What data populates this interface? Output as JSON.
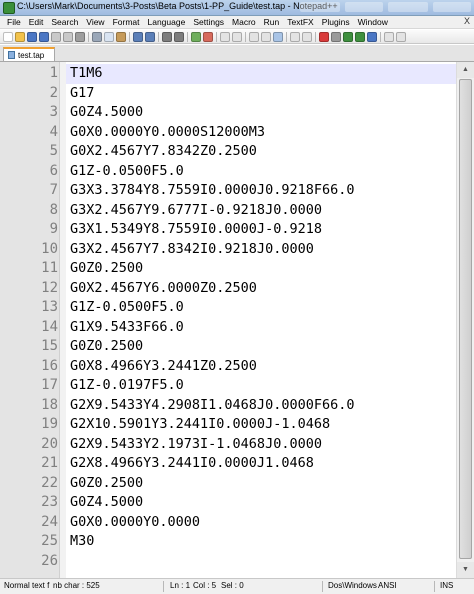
{
  "window": {
    "title": "C:\\Users\\Mark\\Documents\\3-Posts\\Beta Posts\\1-PP_Guide\\test.tap - Notepad++"
  },
  "menu": [
    "File",
    "Edit",
    "Search",
    "View",
    "Format",
    "Language",
    "Settings",
    "Macro",
    "Run",
    "TextFX",
    "Plugins",
    "Window"
  ],
  "menu_close": "X",
  "toolbar": {
    "buttons": [
      {
        "name": "new-file-icon",
        "color": "#ffffff"
      },
      {
        "name": "open-file-icon",
        "color": "#f2c24b"
      },
      {
        "name": "save-icon",
        "color": "#4a76c4"
      },
      {
        "name": "save-all-icon",
        "color": "#4a76c4"
      },
      {
        "name": "close-icon",
        "color": "#c9c9c9"
      },
      {
        "name": "close-all-icon",
        "color": "#c9c9c9"
      },
      {
        "name": "print-icon",
        "color": "#9e9e9e"
      },
      {
        "sep": true
      },
      {
        "name": "cut-icon",
        "color": "#9aa7b8"
      },
      {
        "name": "copy-icon",
        "color": "#d9e4f2"
      },
      {
        "name": "paste-icon",
        "color": "#c69b5a"
      },
      {
        "sep": true
      },
      {
        "name": "undo-icon",
        "color": "#5b7fb8"
      },
      {
        "name": "redo-icon",
        "color": "#5b7fb8"
      },
      {
        "sep": true
      },
      {
        "name": "find-icon",
        "color": "#7d7d7d"
      },
      {
        "name": "replace-icon",
        "color": "#7d7d7d"
      },
      {
        "sep": true
      },
      {
        "name": "zoom-in-icon",
        "color": "#6fae5c"
      },
      {
        "name": "zoom-out-icon",
        "color": "#d76a5c"
      },
      {
        "sep": true
      },
      {
        "name": "sync-v-icon",
        "color": "#e3e3e3"
      },
      {
        "name": "sync-h-icon",
        "color": "#e3e3e3"
      },
      {
        "sep": true
      },
      {
        "name": "word-wrap-icon",
        "color": "#e3e3e3"
      },
      {
        "name": "show-all-chars-icon",
        "color": "#e3e3e3"
      },
      {
        "name": "indent-guide-icon",
        "color": "#a9c4e6"
      },
      {
        "sep": true
      },
      {
        "name": "user-lang-icon",
        "color": "#e3e3e3"
      },
      {
        "name": "doc-map-icon",
        "color": "#e3e3e3"
      },
      {
        "sep": true
      },
      {
        "name": "record-macro-icon",
        "color": "#d93b3b"
      },
      {
        "name": "stop-macro-icon",
        "color": "#9a9a9a"
      },
      {
        "name": "play-macro-icon",
        "color": "#3e8f3e"
      },
      {
        "name": "play-multiple-icon",
        "color": "#3e8f3e"
      },
      {
        "name": "save-macro-icon",
        "color": "#4a76c4"
      },
      {
        "sep": true
      },
      {
        "name": "spell-check-icon",
        "color": "#e3e3e3"
      },
      {
        "name": "abc-icon",
        "color": "#e3e3e3"
      }
    ]
  },
  "tab": {
    "label": "test.tap"
  },
  "editor": {
    "lines": [
      {
        "n": "1",
        "text": "T1M6"
      },
      {
        "n": "2",
        "text": "G17"
      },
      {
        "n": "3",
        "text": "G0Z4.5000"
      },
      {
        "n": "4",
        "text": "G0X0.0000Y0.0000S12000M3"
      },
      {
        "n": "5",
        "text": "G0X2.4567Y7.8342Z0.2500"
      },
      {
        "n": "6",
        "text": "G1Z-0.0500F5.0"
      },
      {
        "n": "7",
        "text": "G3X3.3784Y8.7559I0.0000J0.9218F66.0"
      },
      {
        "n": "8",
        "text": "G3X2.4567Y9.6777I-0.9218J0.0000"
      },
      {
        "n": "9",
        "text": "G3X1.5349Y8.7559I0.0000J-0.9218"
      },
      {
        "n": "10",
        "text": "G3X2.4567Y7.8342I0.9218J0.0000"
      },
      {
        "n": "11",
        "text": "G0Z0.2500"
      },
      {
        "n": "12",
        "text": "G0X2.4567Y6.0000Z0.2500"
      },
      {
        "n": "13",
        "text": "G1Z-0.0500F5.0"
      },
      {
        "n": "14",
        "text": "G1X9.5433F66.0"
      },
      {
        "n": "15",
        "text": "G0Z0.2500"
      },
      {
        "n": "16",
        "text": "G0X8.4966Y3.2441Z0.2500"
      },
      {
        "n": "17",
        "text": "G1Z-0.0197F5.0"
      },
      {
        "n": "18",
        "text": "G2X9.5433Y4.2908I1.0468J0.0000F66.0"
      },
      {
        "n": "19",
        "text": "G2X10.5901Y3.2441I0.0000J-1.0468"
      },
      {
        "n": "20",
        "text": "G2X9.5433Y2.1973I-1.0468J0.0000"
      },
      {
        "n": "21",
        "text": "G2X8.4966Y3.2441I0.0000J1.0468"
      },
      {
        "n": "22",
        "text": "G0Z0.2500"
      },
      {
        "n": "23",
        "text": "G0Z4.5000"
      },
      {
        "n": "24",
        "text": "G0X0.0000Y0.0000"
      },
      {
        "n": "25",
        "text": "M30"
      },
      {
        "n": "26",
        "text": ""
      }
    ]
  },
  "status": {
    "doc_type": "Normal text f",
    "length": "nb char : 525",
    "ln": "Ln : 1",
    "col": "Col : 5",
    "sel": "Sel : 0",
    "eol": "Dos\\Windows",
    "encoding": "ANSI",
    "mode": "INS"
  }
}
